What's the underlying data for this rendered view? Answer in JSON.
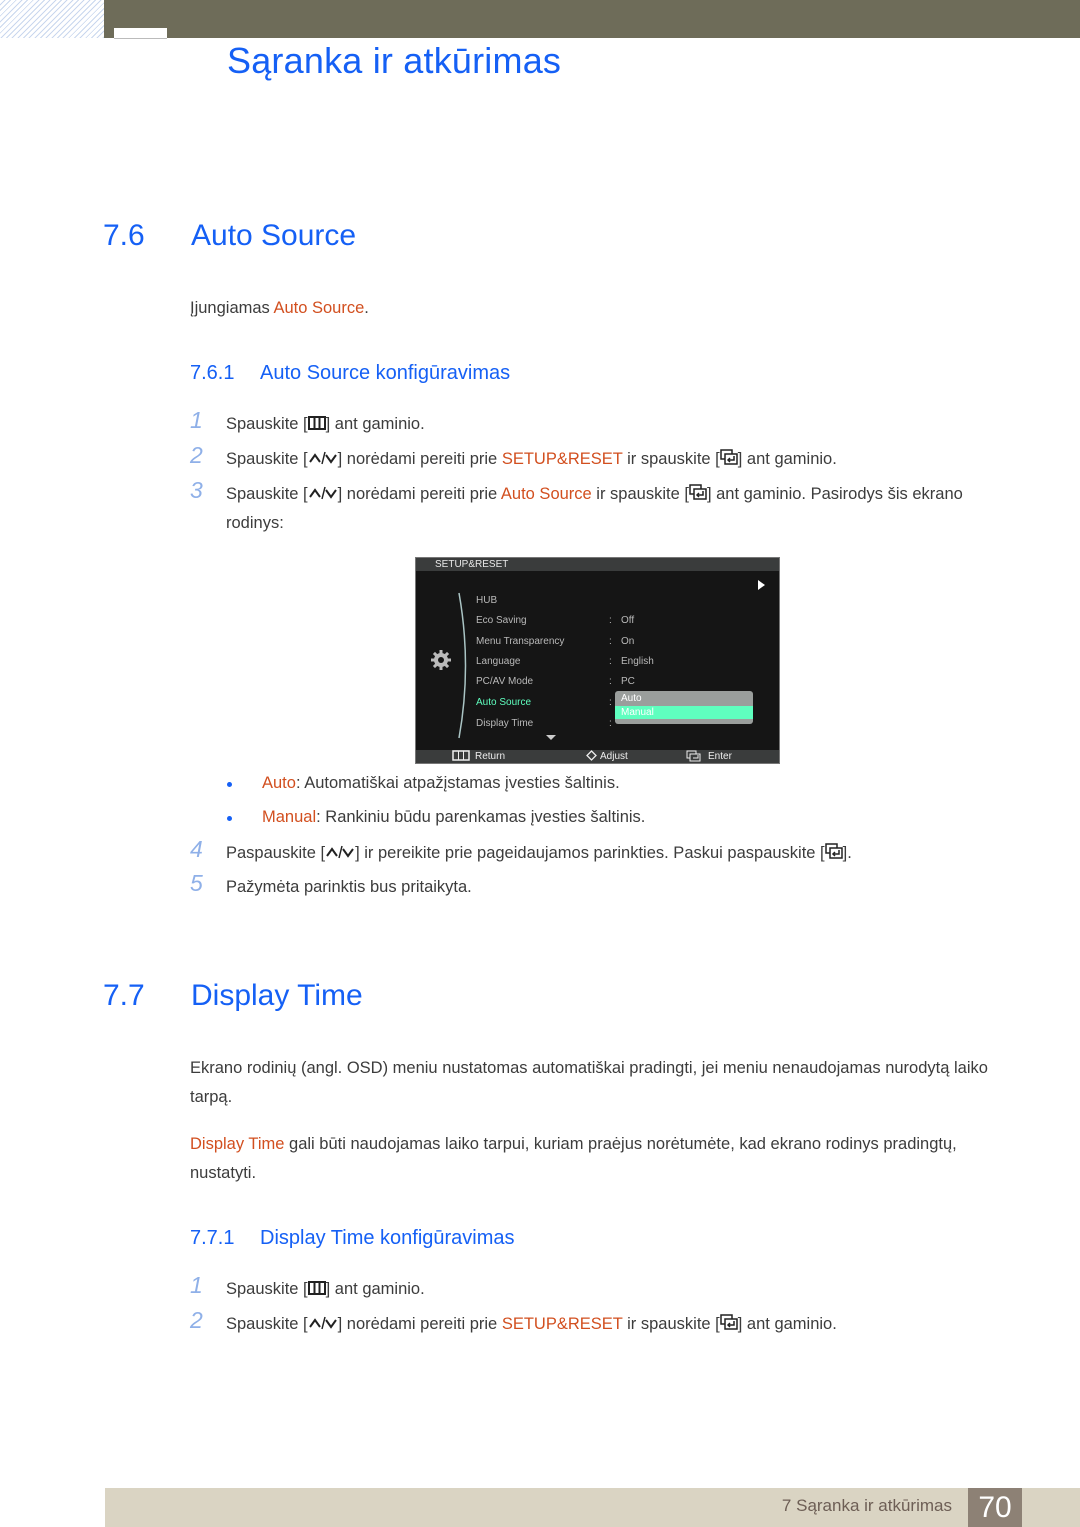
{
  "header": {
    "chapter_title": "Sąranka ir atkūrimas"
  },
  "section_7_6": {
    "number": "7.6",
    "title": "Auto Source",
    "intro_prefix": "Įjungiamas ",
    "intro_highlight": "Auto Source",
    "intro_suffix": ".",
    "sub": {
      "number": "7.6.1",
      "title": "Auto Source konfigūravimas"
    },
    "steps": [
      {
        "n": "1",
        "a": "Spauskite [",
        "b": "] ant gaminio."
      },
      {
        "n": "2",
        "a": "Spauskite [",
        "b": "] norėdami pereiti prie ",
        "hl": "SETUP&RESET",
        "c": " ir spauskite [",
        "d": "] ant gaminio."
      },
      {
        "n": "3",
        "a": "Spauskite [",
        "b": "] norėdami pereiti prie ",
        "hl": "Auto Source",
        "c": " ir spauskite [",
        "d": "] ant gaminio. Pasirodys šis ekrano rodinys:"
      },
      {
        "n": "4",
        "a": "Paspauskite [",
        "b": "] ir pereikite prie pageidaujamos parinkties. Paskui paspauskite [",
        "c": "]."
      },
      {
        "n": "5",
        "a": "Pažymėta parinktis bus pritaikyta."
      }
    ],
    "bullets": [
      {
        "hl": "Auto",
        "text": ": Automatiškai atpažįstamas įvesties šaltinis."
      },
      {
        "hl": "Manual",
        "text": ": Rankiniu būdu parenkamas įvesties šaltinis."
      }
    ]
  },
  "osd": {
    "header": "SETUP&RESET",
    "items": [
      {
        "label": "HUB",
        "value": ""
      },
      {
        "label": "Eco Saving",
        "value": "Off"
      },
      {
        "label": "Menu Transparency",
        "value": "On"
      },
      {
        "label": "Language",
        "value": "English"
      },
      {
        "label": "PC/AV Mode",
        "value": "PC"
      },
      {
        "label": "Auto Source",
        "value": ""
      },
      {
        "label": "Display Time",
        "value": ""
      }
    ],
    "dropdown_options": [
      "Auto",
      "Manual"
    ],
    "selected_option": "Manual",
    "footer": {
      "return": "Return",
      "adjust": "Adjust",
      "enter": "Enter"
    },
    "active_color": "#5fffbf"
  },
  "section_7_7": {
    "number": "7.7",
    "title": "Display Time",
    "para1": "Ekrano rodinių (angl. OSD) meniu nustatomas automatiškai pradingti, jei meniu nenaudojamas nurodytą laiko tarpą.",
    "para2_highlight": "Display Time",
    "para2_text": " gali būti naudojamas laiko tarpui, kuriam praėjus norėtumėte, kad ekrano rodinys pradingtų, nustatyti.",
    "sub": {
      "number": "7.7.1",
      "title": "Display Time konfigūravimas"
    },
    "steps": [
      {
        "n": "1",
        "a": "Spauskite [",
        "b": "] ant gaminio."
      },
      {
        "n": "2",
        "a": "Spauskite [",
        "b": "] norėdami pereiti prie ",
        "hl": "SETUP&RESET",
        "c": " ir spauskite [",
        "d": "] ant gaminio."
      }
    ]
  },
  "footer": {
    "label": "7 Sąranka ir atkūrimas",
    "page_number": "70"
  },
  "colors": {
    "heading_blue": "#1560f5",
    "highlight_orange": "#d24f1f",
    "step_number": "#8fb0e8"
  }
}
